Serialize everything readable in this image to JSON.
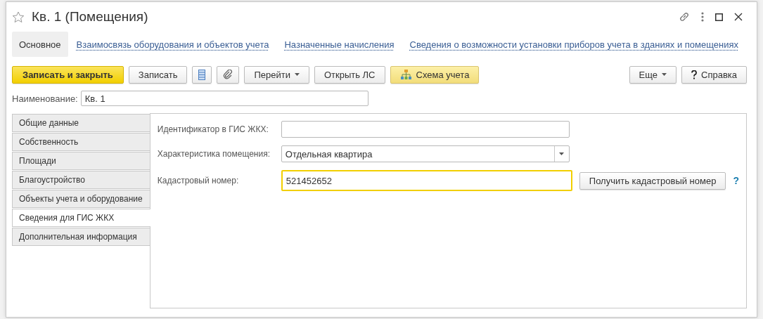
{
  "window": {
    "title": "Кв. 1 (Помещения)",
    "favorite": false
  },
  "nav": [
    {
      "label": "Основное",
      "selected": true
    },
    {
      "label": "Взаимосвязь оборудования и объектов учета",
      "selected": false
    },
    {
      "label": "Назначенные начисления",
      "selected": false
    },
    {
      "label": "Сведения о возможности установки приборов учета в зданиях и помещениях",
      "selected": false
    }
  ],
  "toolbar_left": [
    {
      "kind": "primary",
      "label": "Записать и закрыть"
    },
    {
      "kind": "plain",
      "label": "Записать"
    },
    {
      "kind": "list"
    },
    {
      "kind": "attach"
    },
    {
      "kind": "dropdown",
      "label": "Перейти"
    },
    {
      "kind": "plain",
      "label": "Открыть ЛС"
    },
    {
      "kind": "scheme",
      "label": "Схема учета"
    }
  ],
  "toolbar_right": [
    {
      "kind": "dropdown",
      "label": "Еще"
    },
    {
      "kind": "help",
      "label": "Справка"
    }
  ],
  "name_field": {
    "label": "Наименование:",
    "value": "Кв. 1"
  },
  "tabs": [
    {
      "label": "Общие данные",
      "selected": false
    },
    {
      "label": "Собственность",
      "selected": false
    },
    {
      "label": "Площади",
      "selected": false
    },
    {
      "label": "Благоустройство",
      "selected": false
    },
    {
      "label": "Объекты учета и оборудование",
      "selected": false
    },
    {
      "label": "Сведения для ГИС ЖКХ",
      "selected": true
    },
    {
      "label": "Дополнительная информация",
      "selected": false
    }
  ],
  "fields": [
    {
      "kind": "text",
      "label": "Идентификатор в ГИС ЖКХ:"
    },
    {
      "kind": "select",
      "label": "Характеристика помещения:",
      "value": "Отдельная квартира"
    },
    {
      "kind": "text",
      "label": "Кадастровый номер:",
      "value": "521452652",
      "focused": true,
      "button": "Получить кадастровый номер",
      "help": "?"
    }
  ]
}
